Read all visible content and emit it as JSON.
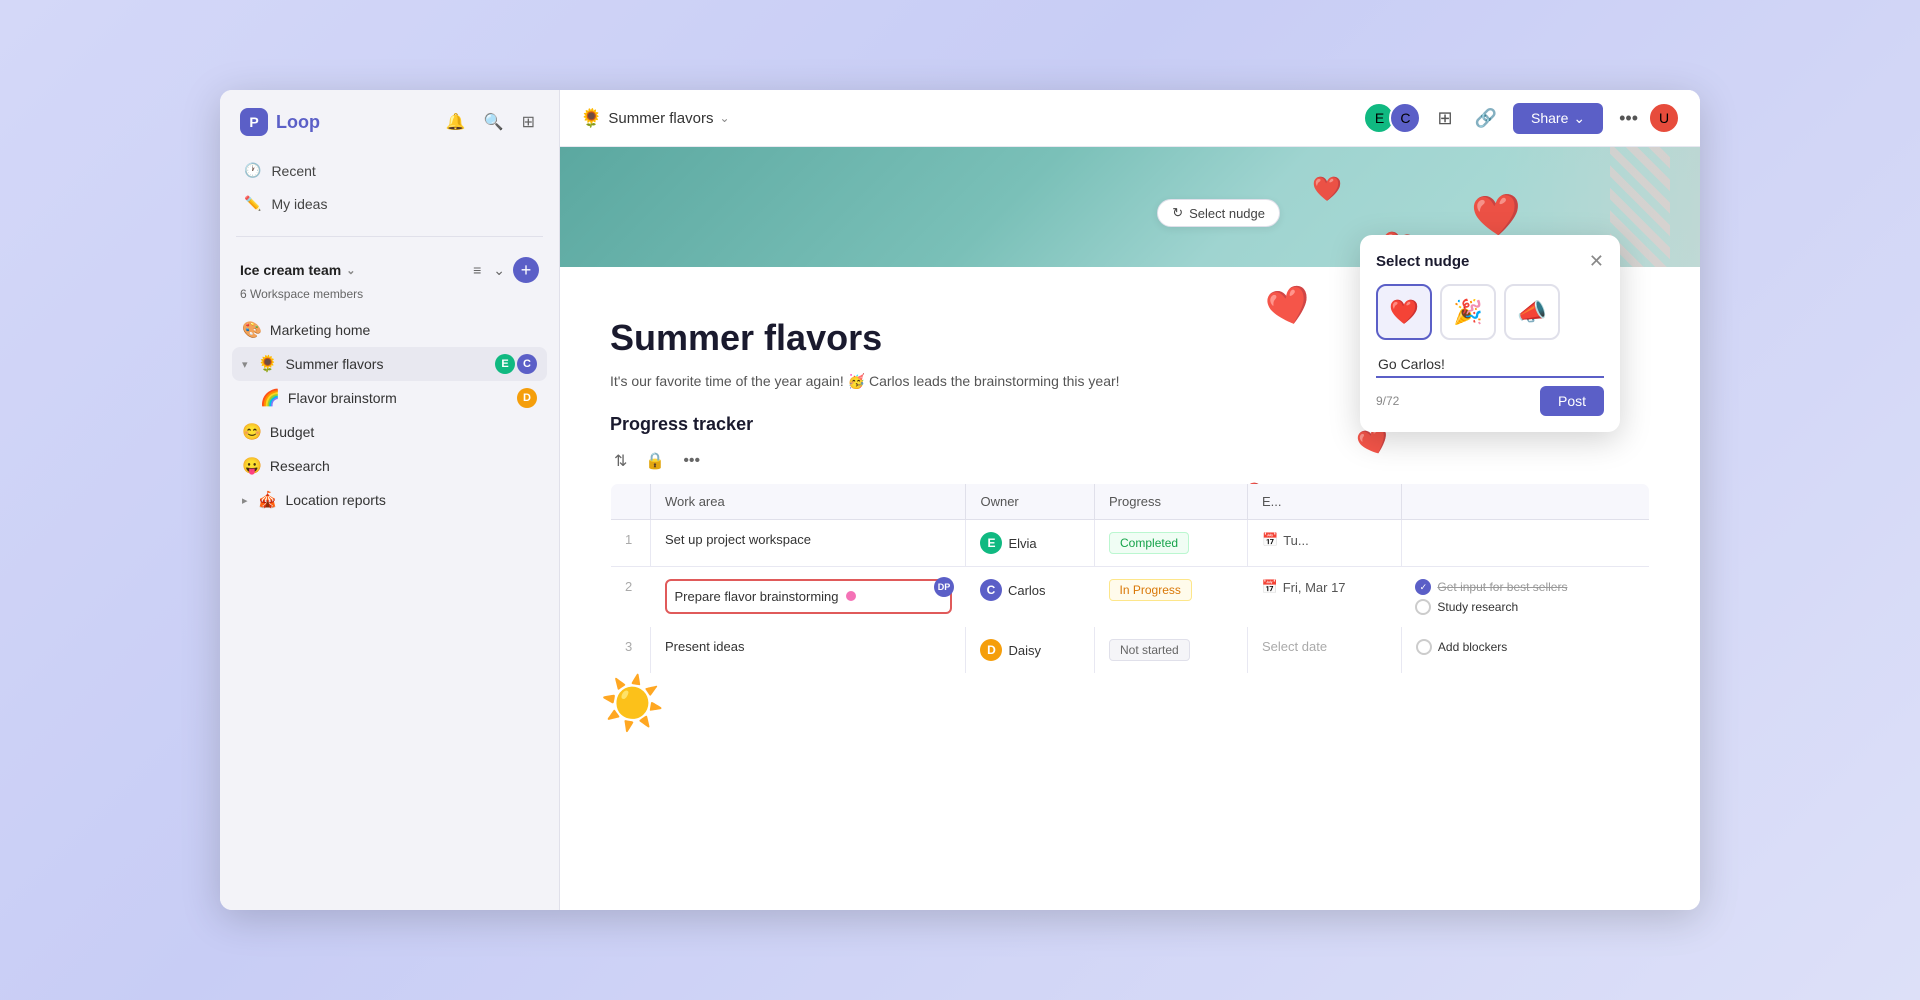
{
  "app": {
    "name": "Loop",
    "logo_char": "P"
  },
  "sidebar": {
    "nav_items": [
      {
        "id": "recent",
        "label": "Recent",
        "icon": "clock"
      },
      {
        "id": "my-ideas",
        "label": "My ideas",
        "icon": "edit"
      }
    ],
    "workspace": {
      "name": "Ice cream team",
      "members_count": "6 Workspace members"
    },
    "tree": [
      {
        "id": "marketing-home",
        "label": "Marketing home",
        "emoji": "🎨",
        "indent": 0
      },
      {
        "id": "summer-flavors",
        "label": "Summer flavors",
        "emoji": "🌻",
        "indent": 0,
        "active": true,
        "has_avatars": true
      },
      {
        "id": "flavor-brainstorm",
        "label": "Flavor brainstorm",
        "emoji": "🌈",
        "indent": 1
      },
      {
        "id": "budget",
        "label": "Budget",
        "emoji": "😊",
        "indent": 0
      },
      {
        "id": "research",
        "label": "Research",
        "emoji": "😛",
        "indent": 0
      },
      {
        "id": "location-reports",
        "label": "Location reports",
        "emoji": "🎪",
        "indent": 0
      }
    ]
  },
  "topbar": {
    "page_emoji": "🌻",
    "page_title": "Summer flavors",
    "share_label": "Share"
  },
  "page": {
    "icon": "☀️",
    "title": "Summer flavors",
    "description": "It's our favorite time of the year again! 🥳 Carlos leads the brainstorming this year!",
    "section_title": "Progress tracker"
  },
  "tracker": {
    "columns": [
      "Work area",
      "Owner",
      "Progress",
      "E..."
    ],
    "rows": [
      {
        "num": "1",
        "work_area": "Set up project workspace",
        "owner": "Elvia",
        "owner_color": "#10b981",
        "progress": "Completed",
        "progress_type": "completed",
        "date": "Tu...",
        "tasks": []
      },
      {
        "num": "2",
        "work_area": "Prepare flavor brainstorming",
        "owner": "Carlos",
        "owner_color": "#5b5fc7",
        "progress": "In Progress",
        "progress_type": "inprogress",
        "date": "Fri, Mar 17",
        "highlighted": true,
        "tasks": [
          {
            "label": "Get input for best sellers",
            "done": true
          },
          {
            "label": "Study research",
            "done": false
          }
        ]
      },
      {
        "num": "3",
        "work_area": "Present ideas",
        "owner": "Daisy",
        "owner_color": "#f59e0b",
        "progress": "Not started",
        "progress_type": "notstarted",
        "date": "Select date",
        "tasks": [
          {
            "label": "Add blockers",
            "done": false
          }
        ]
      }
    ]
  },
  "nudge": {
    "trigger_label": "Select nudge",
    "popup_title": "Select nudge",
    "emojis": [
      "❤️",
      "🎉",
      "📣"
    ],
    "selected_emoji_index": 0,
    "input_value": "Go Carlos!",
    "char_count": "9/72",
    "post_label": "Post"
  },
  "hearts": [
    "❤️",
    "❤️",
    "❤️",
    "❤️",
    "❤️",
    "❤️",
    "❤️",
    "❤️",
    "❤️",
    "❤️"
  ]
}
